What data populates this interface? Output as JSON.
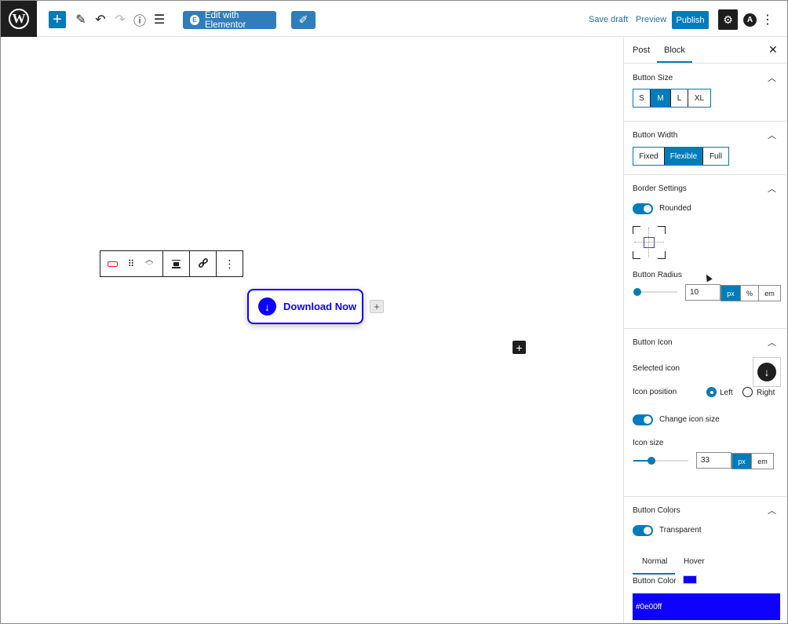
{
  "toolbar": {
    "edit_with_elementor": "Edit with Elementor",
    "save_draft": "Save draft",
    "preview": "Preview",
    "publish": "Publish"
  },
  "canvas": {
    "button_label": "Download Now",
    "button_color": "#0e00ff"
  },
  "sidebar": {
    "tabs": {
      "post": "Post",
      "block": "Block"
    },
    "button_size": {
      "title": "Button Size",
      "options": [
        "S",
        "M",
        "L",
        "XL"
      ],
      "selected": "M"
    },
    "button_width": {
      "title": "Button Width",
      "options": [
        "Fixed",
        "Flexible",
        "Full"
      ],
      "selected": "Flexible"
    },
    "border_settings": {
      "title": "Border Settings",
      "rounded_label": "Rounded",
      "radius_label": "Button Radius",
      "radius_value": "10",
      "units": [
        "px",
        "%",
        "em"
      ],
      "selected_unit": "px"
    },
    "button_icon": {
      "title": "Button Icon",
      "selected_icon_label": "Selected icon",
      "icon_position_label": "Icon position",
      "position_left": "Left",
      "position_right": "Right",
      "selected_position": "Left",
      "change_size_label": "Change icon size",
      "icon_size_label": "Icon size",
      "icon_size_value": "33",
      "units": [
        "px",
        "em"
      ],
      "selected_unit": "px"
    },
    "button_colors": {
      "title": "Button Colors",
      "transparent_label": "Transparent",
      "state_tabs": [
        "Normal",
        "Hover"
      ],
      "button_color_label": "Button Color",
      "button_color_value": "#0e00ff"
    }
  }
}
